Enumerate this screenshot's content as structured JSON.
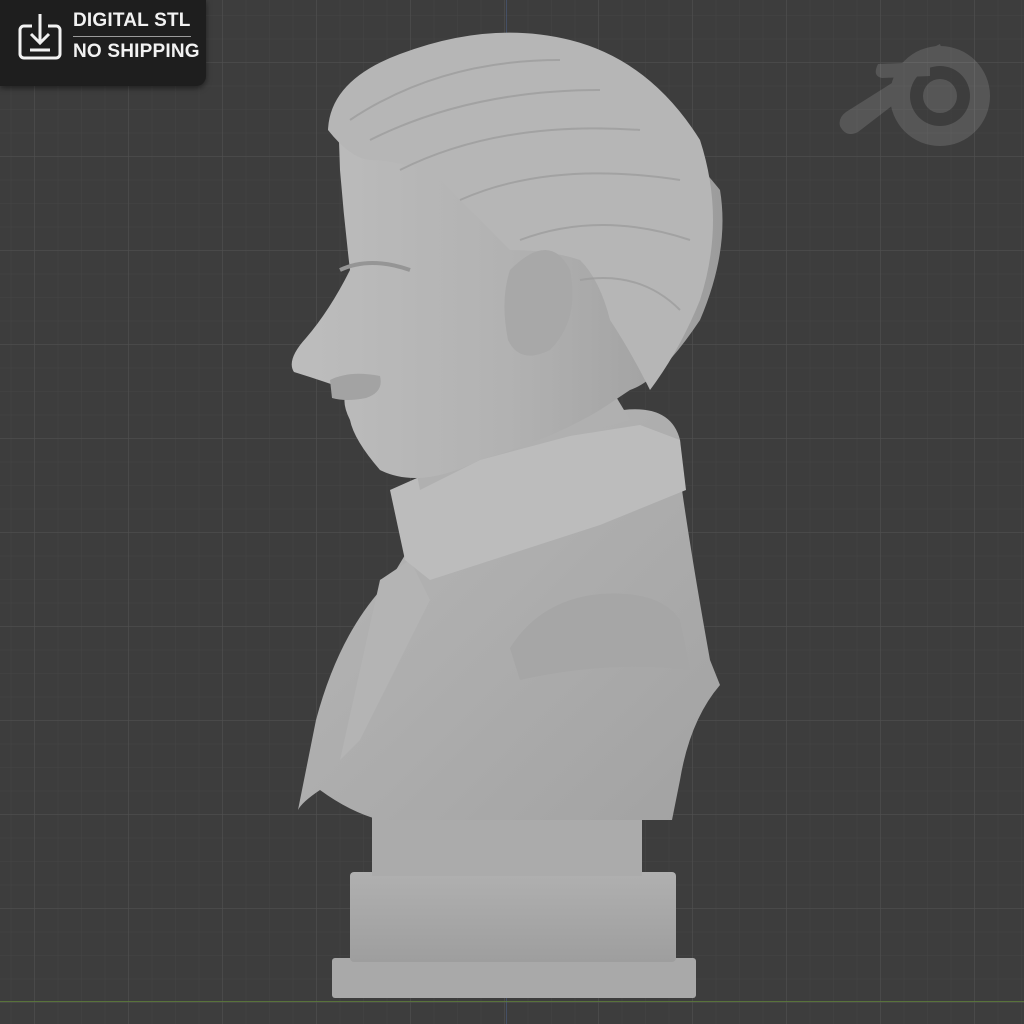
{
  "badge": {
    "line1": "DIGITAL STL",
    "line2": "NO SHIPPING",
    "icon": "download-icon"
  },
  "viewport": {
    "background": "#3d3d3d",
    "model": "bust-sculpture",
    "watermark": "blender-logo-icon"
  }
}
